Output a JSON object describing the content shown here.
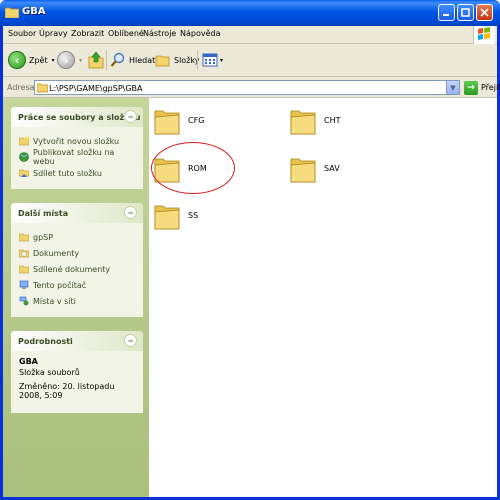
{
  "window": {
    "title": "GBA",
    "controls": [
      "minimize",
      "maximize",
      "close"
    ]
  },
  "menu": {
    "items": [
      "Soubor",
      "Úpravy",
      "Zobrazit",
      "Oblíbené",
      "Nástroje",
      "Nápověda"
    ]
  },
  "toolbar": {
    "back_label": "Zpět",
    "search_label": "Hledat",
    "folders_label": "Složky"
  },
  "address": {
    "label": "Adresa",
    "path": "L:\\PSP\\GAME\\gpSP\\GBA",
    "go_label": "Přejít"
  },
  "tasks_panel": {
    "title": "Práce se soubory a složkou",
    "items": [
      "Vytvořit novou složku",
      "Publikovat složku na webu",
      "Sdílet tuto složku"
    ]
  },
  "places_panel": {
    "title": "Další místa",
    "items": [
      "gpSP",
      "Dokumenty",
      "Sdílené dokumenty",
      "Tento počítač",
      "Místa v síti"
    ]
  },
  "details_panel": {
    "title": "Podrobnosti",
    "name": "GBA",
    "type": "Složka souborů",
    "modified": "Změněno: 20. listopadu 2008, 5:09"
  },
  "folders": [
    {
      "name": "CFG"
    },
    {
      "name": "CHT"
    },
    {
      "name": "ROM",
      "highlighted": true
    },
    {
      "name": "SAV"
    },
    {
      "name": "SS"
    }
  ],
  "colors": {
    "titlebar": "#0055e5",
    "highlight_circle": "#d31d1d",
    "left_pane": "#c5d59b"
  }
}
